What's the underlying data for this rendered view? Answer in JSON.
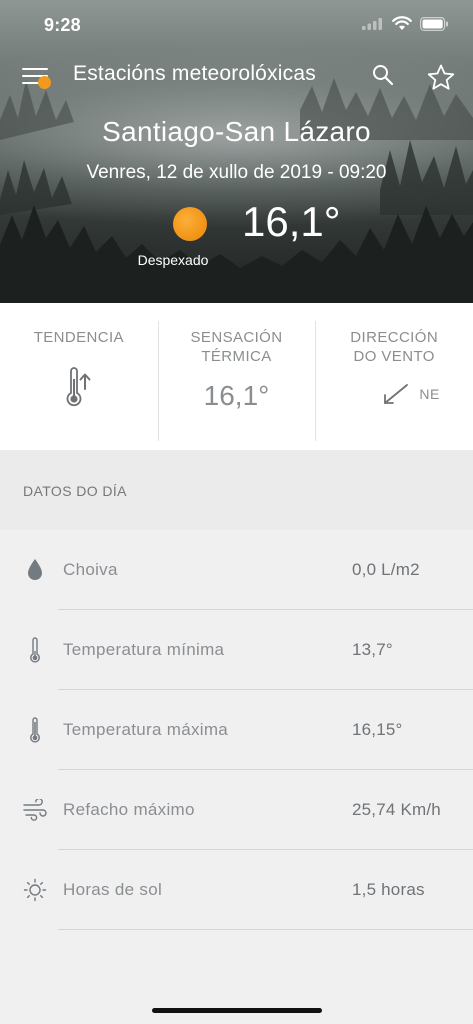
{
  "status": {
    "time": "9:28"
  },
  "header": {
    "title": "Estacións meteorolóxicas"
  },
  "current": {
    "station": "Santiago-San Lázaro",
    "date": "Venres, 12 de xullo  de 2019 - 09:20",
    "temperature": "16,1°",
    "condition": "Despexado"
  },
  "summary": {
    "trend_label": "TENDENCIA",
    "feels_label": "SENSACIÓN TÉRMICA",
    "feels_value": "16,1°",
    "wind_label": "DIRECCIÓN DO VENTO",
    "wind_direction": "NE"
  },
  "day_data": {
    "title": "DATOS DO DÍA",
    "rows": [
      {
        "label": "Choiva",
        "value": "0,0 L/m2",
        "icon": "raindrop-icon"
      },
      {
        "label": "Temperatura mínima",
        "value": "13,7°",
        "icon": "thermometer-low-icon"
      },
      {
        "label": "Temperatura máxima",
        "value": "16,15°",
        "icon": "thermometer-high-icon"
      },
      {
        "label": "Refacho máximo",
        "value": "25,74 Km/h",
        "icon": "wind-icon"
      },
      {
        "label": "Horas de sol",
        "value": "1,5 horas",
        "icon": "sun-icon"
      }
    ]
  },
  "colors": {
    "accent": "#f29a1f",
    "text_grey": "#8a8e91",
    "background": "#f0f0f1"
  }
}
